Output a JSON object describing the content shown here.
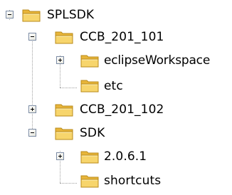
{
  "tree": {
    "nodes": [
      {
        "label": "SPLSDK",
        "state": "expanded",
        "depth": 0
      },
      {
        "label": "CCB_201_101",
        "state": "expanded",
        "depth": 1
      },
      {
        "label": "eclipseWorkspace",
        "state": "collapsed",
        "depth": 2
      },
      {
        "label": "etc",
        "state": "leaf",
        "depth": 2
      },
      {
        "label": "CCB_201_102",
        "state": "collapsed",
        "depth": 1
      },
      {
        "label": "SDK",
        "state": "expanded",
        "depth": 1
      },
      {
        "label": "2.0.6.1",
        "state": "collapsed",
        "depth": 2
      },
      {
        "label": "shortcuts",
        "state": "leaf",
        "depth": 2
      }
    ]
  },
  "colors": {
    "connector": "#a0a0a0",
    "toggle_border": "#7a8aa3",
    "folder_fill": "#f7d56c",
    "folder_back": "#e8b53a",
    "folder_edge": "#b88a1a"
  }
}
